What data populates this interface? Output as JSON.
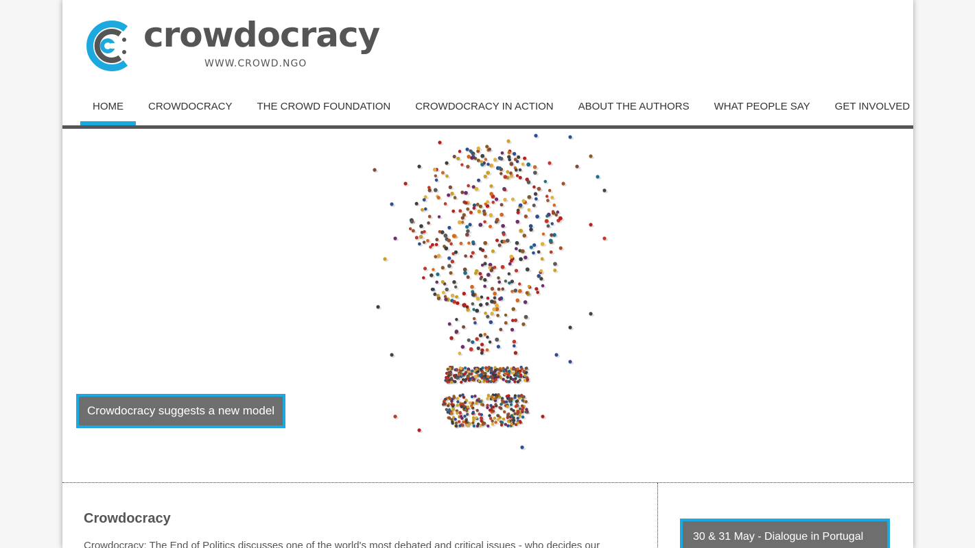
{
  "brand": {
    "name": "crowdocracy",
    "url": "WWW.CROWD.NGO",
    "colors": {
      "accent": "#1ba9df",
      "dark": "#555555",
      "caption_bg": "#6e6e6e"
    }
  },
  "nav": {
    "items": [
      {
        "label": "HOME",
        "active": true
      },
      {
        "label": "CROWDOCRACY",
        "active": false
      },
      {
        "label": "THE CROWD FOUNDATION",
        "active": false
      },
      {
        "label": "CROWDOCRACY IN ACTION",
        "active": false
      },
      {
        "label": "ABOUT THE AUTHORS",
        "active": false
      },
      {
        "label": "WHAT PEOPLE SAY",
        "active": false
      },
      {
        "label": "GET INVOLVED",
        "active": false
      }
    ]
  },
  "hero": {
    "image": "crowd-lightbulb-image",
    "caption": "Crowdocracy suggests a new model"
  },
  "content": {
    "title": "Crowdocracy",
    "body": "Crowdocracy: The End of Politics discusses one of the world's most debated and critical issues - who decides our"
  },
  "sidebar": {
    "news_label": "30 & 31 May - Dialogue in Portugal"
  }
}
